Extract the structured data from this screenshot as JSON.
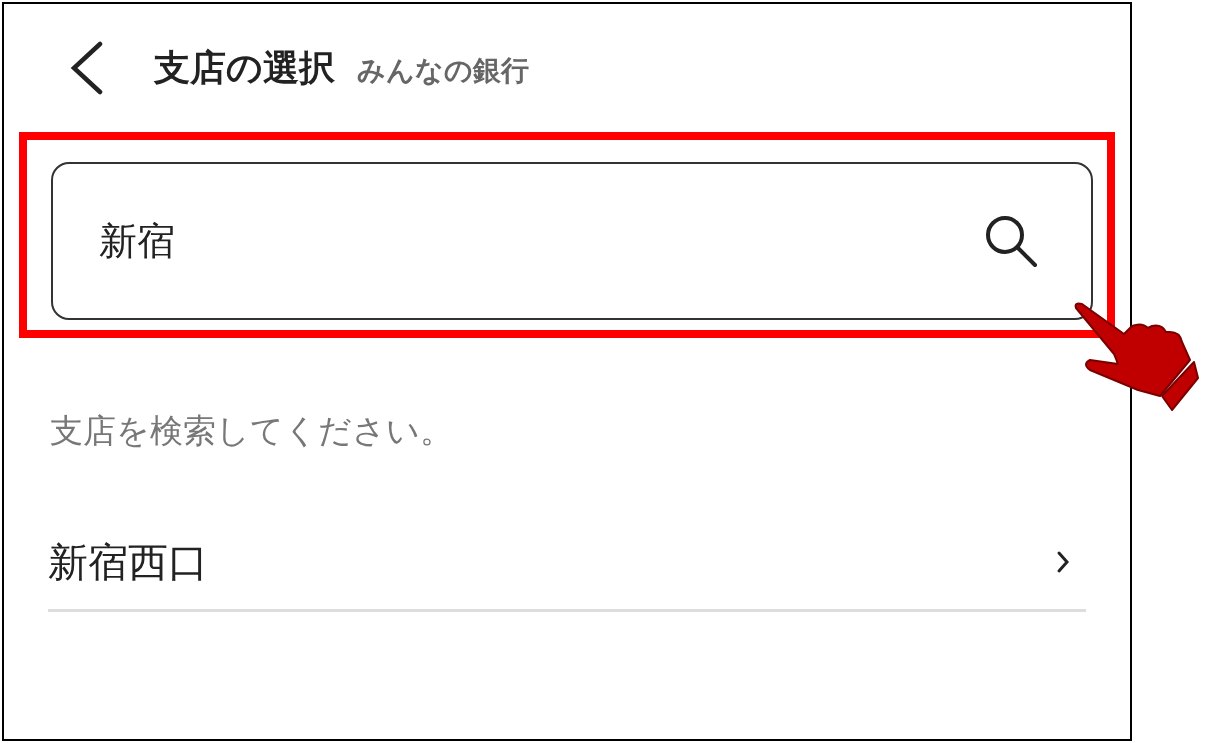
{
  "header": {
    "title": "支店の選択",
    "subtitle": "みんなの銀行"
  },
  "search": {
    "value": "新宿",
    "highlighted": true
  },
  "hint": "支店を検索してください。",
  "results": [
    {
      "label": "新宿西口"
    }
  ]
}
